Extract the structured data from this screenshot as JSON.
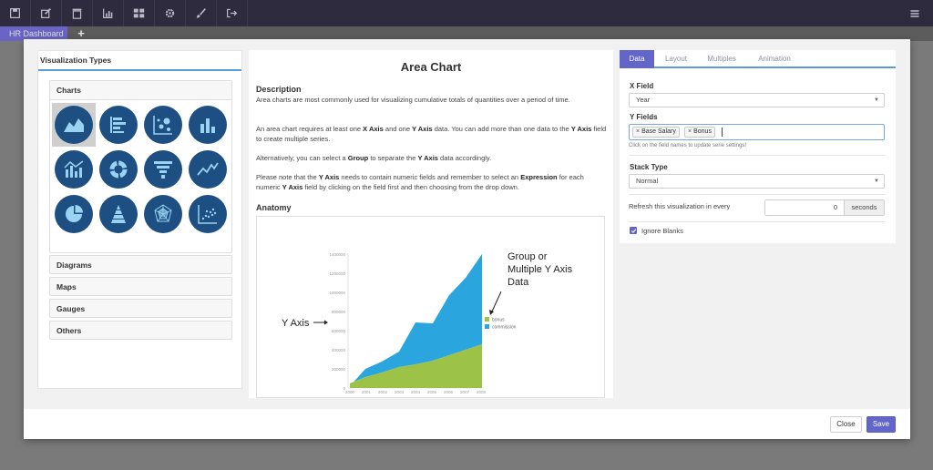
{
  "toolbar": {
    "icons": [
      "save-icon",
      "edit-icon",
      "trash-icon",
      "bar-chart-icon",
      "dashboard-icon",
      "gear-icon",
      "brush-icon",
      "export-icon",
      "menu-icon"
    ]
  },
  "tabs_bar": {
    "active_tab": "HR Dashboard",
    "add_label": "+"
  },
  "left_panel": {
    "title": "Visualization Types",
    "charts_header": "Charts",
    "chart_icons": [
      "area-chart-icon",
      "gantt-chart-icon",
      "bubble-chart-icon",
      "column-chart-icon",
      "combo-chart-icon",
      "donut-chart-icon",
      "funnel-chart-icon",
      "line-chart-icon",
      "pie-chart-icon",
      "pyramid-chart-icon",
      "radar-chart-icon",
      "scatter-chart-icon"
    ],
    "sections": [
      "Diagrams",
      "Maps",
      "Gauges",
      "Others"
    ]
  },
  "center": {
    "title": "Area Chart",
    "description_heading": "Description",
    "anatomy_heading": "Anatomy",
    "anatomy": {
      "y_axis_label": "Y Axis",
      "group_label_1": "Group or",
      "group_label_2": "Multiple Y Axis",
      "group_label_3": "Data",
      "legend": [
        "bonus",
        "commission"
      ],
      "y_ticks": [
        "1400000",
        "1200000",
        "1000000",
        "800000",
        "600000",
        "400000",
        "200000",
        "0"
      ],
      "x_ticks": [
        "2000",
        "2001",
        "2002",
        "2003",
        "2004",
        "2005",
        "2006",
        "2007",
        "2008"
      ]
    }
  },
  "right_panel": {
    "tabs": [
      "Data",
      "Layout",
      "Multiples",
      "Animation"
    ],
    "x_field_label": "X Field",
    "x_field_value": "Year",
    "y_fields_label": "Y Fields",
    "y_fields": [
      "Base Salary",
      "Bonus"
    ],
    "hint": "Click on the field names to update serie settings!",
    "stack_type_label": "Stack Type",
    "stack_type_value": "Normal",
    "refresh_label": "Refresh this visualization in every",
    "refresh_value": "0",
    "refresh_unit": "seconds",
    "ignore_blanks_label": "Ignore Blanks"
  },
  "footer": {
    "close_label": "Close",
    "save_label": "Save"
  },
  "colors": {
    "toolbar_bg": "#2f2b3f",
    "accent": "#6366c9",
    "chart_icon_bg": "#1d4f82",
    "area_blue": "#2aa5dd",
    "area_green": "#9cc247"
  }
}
